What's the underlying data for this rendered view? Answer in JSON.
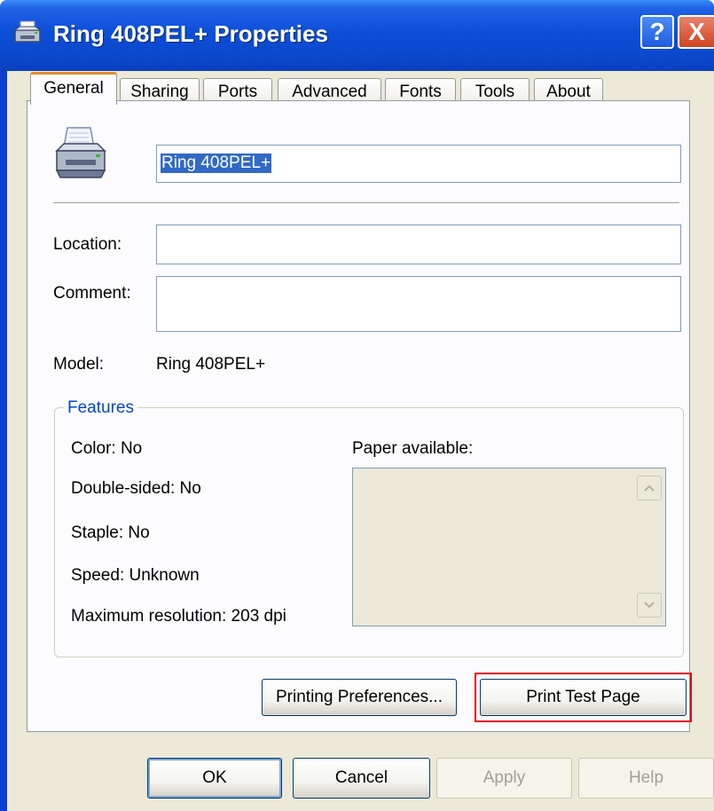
{
  "window": {
    "title": "Ring 408PEL+ Properties",
    "help_label": "?",
    "close_label": "X",
    "icon": "printer-icon"
  },
  "tabs": [
    "General",
    "Sharing",
    "Ports",
    "Advanced",
    "Fonts",
    "Tools",
    "About"
  ],
  "general": {
    "printer_name_value": "Ring 408PEL+",
    "printer_icon": "printer-icon",
    "location_label": "Location:",
    "location_value": "",
    "comment_label": "Comment:",
    "comment_value": "",
    "model_label": "Model:",
    "model_value": "Ring 408PEL+"
  },
  "features": {
    "title": "Features",
    "color": "Color: No",
    "double_sided": "Double-sided: No",
    "staple": "Staple: No",
    "speed": "Speed: Unknown",
    "max_resolution": "Maximum resolution: 203 dpi",
    "paper_label": "Paper available:",
    "paper_items": []
  },
  "buttons": {
    "printing_preferences": "Printing Preferences...",
    "print_test_page": "Print Test Page",
    "ok": "OK",
    "cancel": "Cancel",
    "apply": "Apply",
    "help": "Help"
  },
  "colors": {
    "titlebar": "#0b48cc",
    "active_tab_accent": "#e68b2c",
    "group_title": "#0046d5",
    "highlight": "#e8000b"
  }
}
